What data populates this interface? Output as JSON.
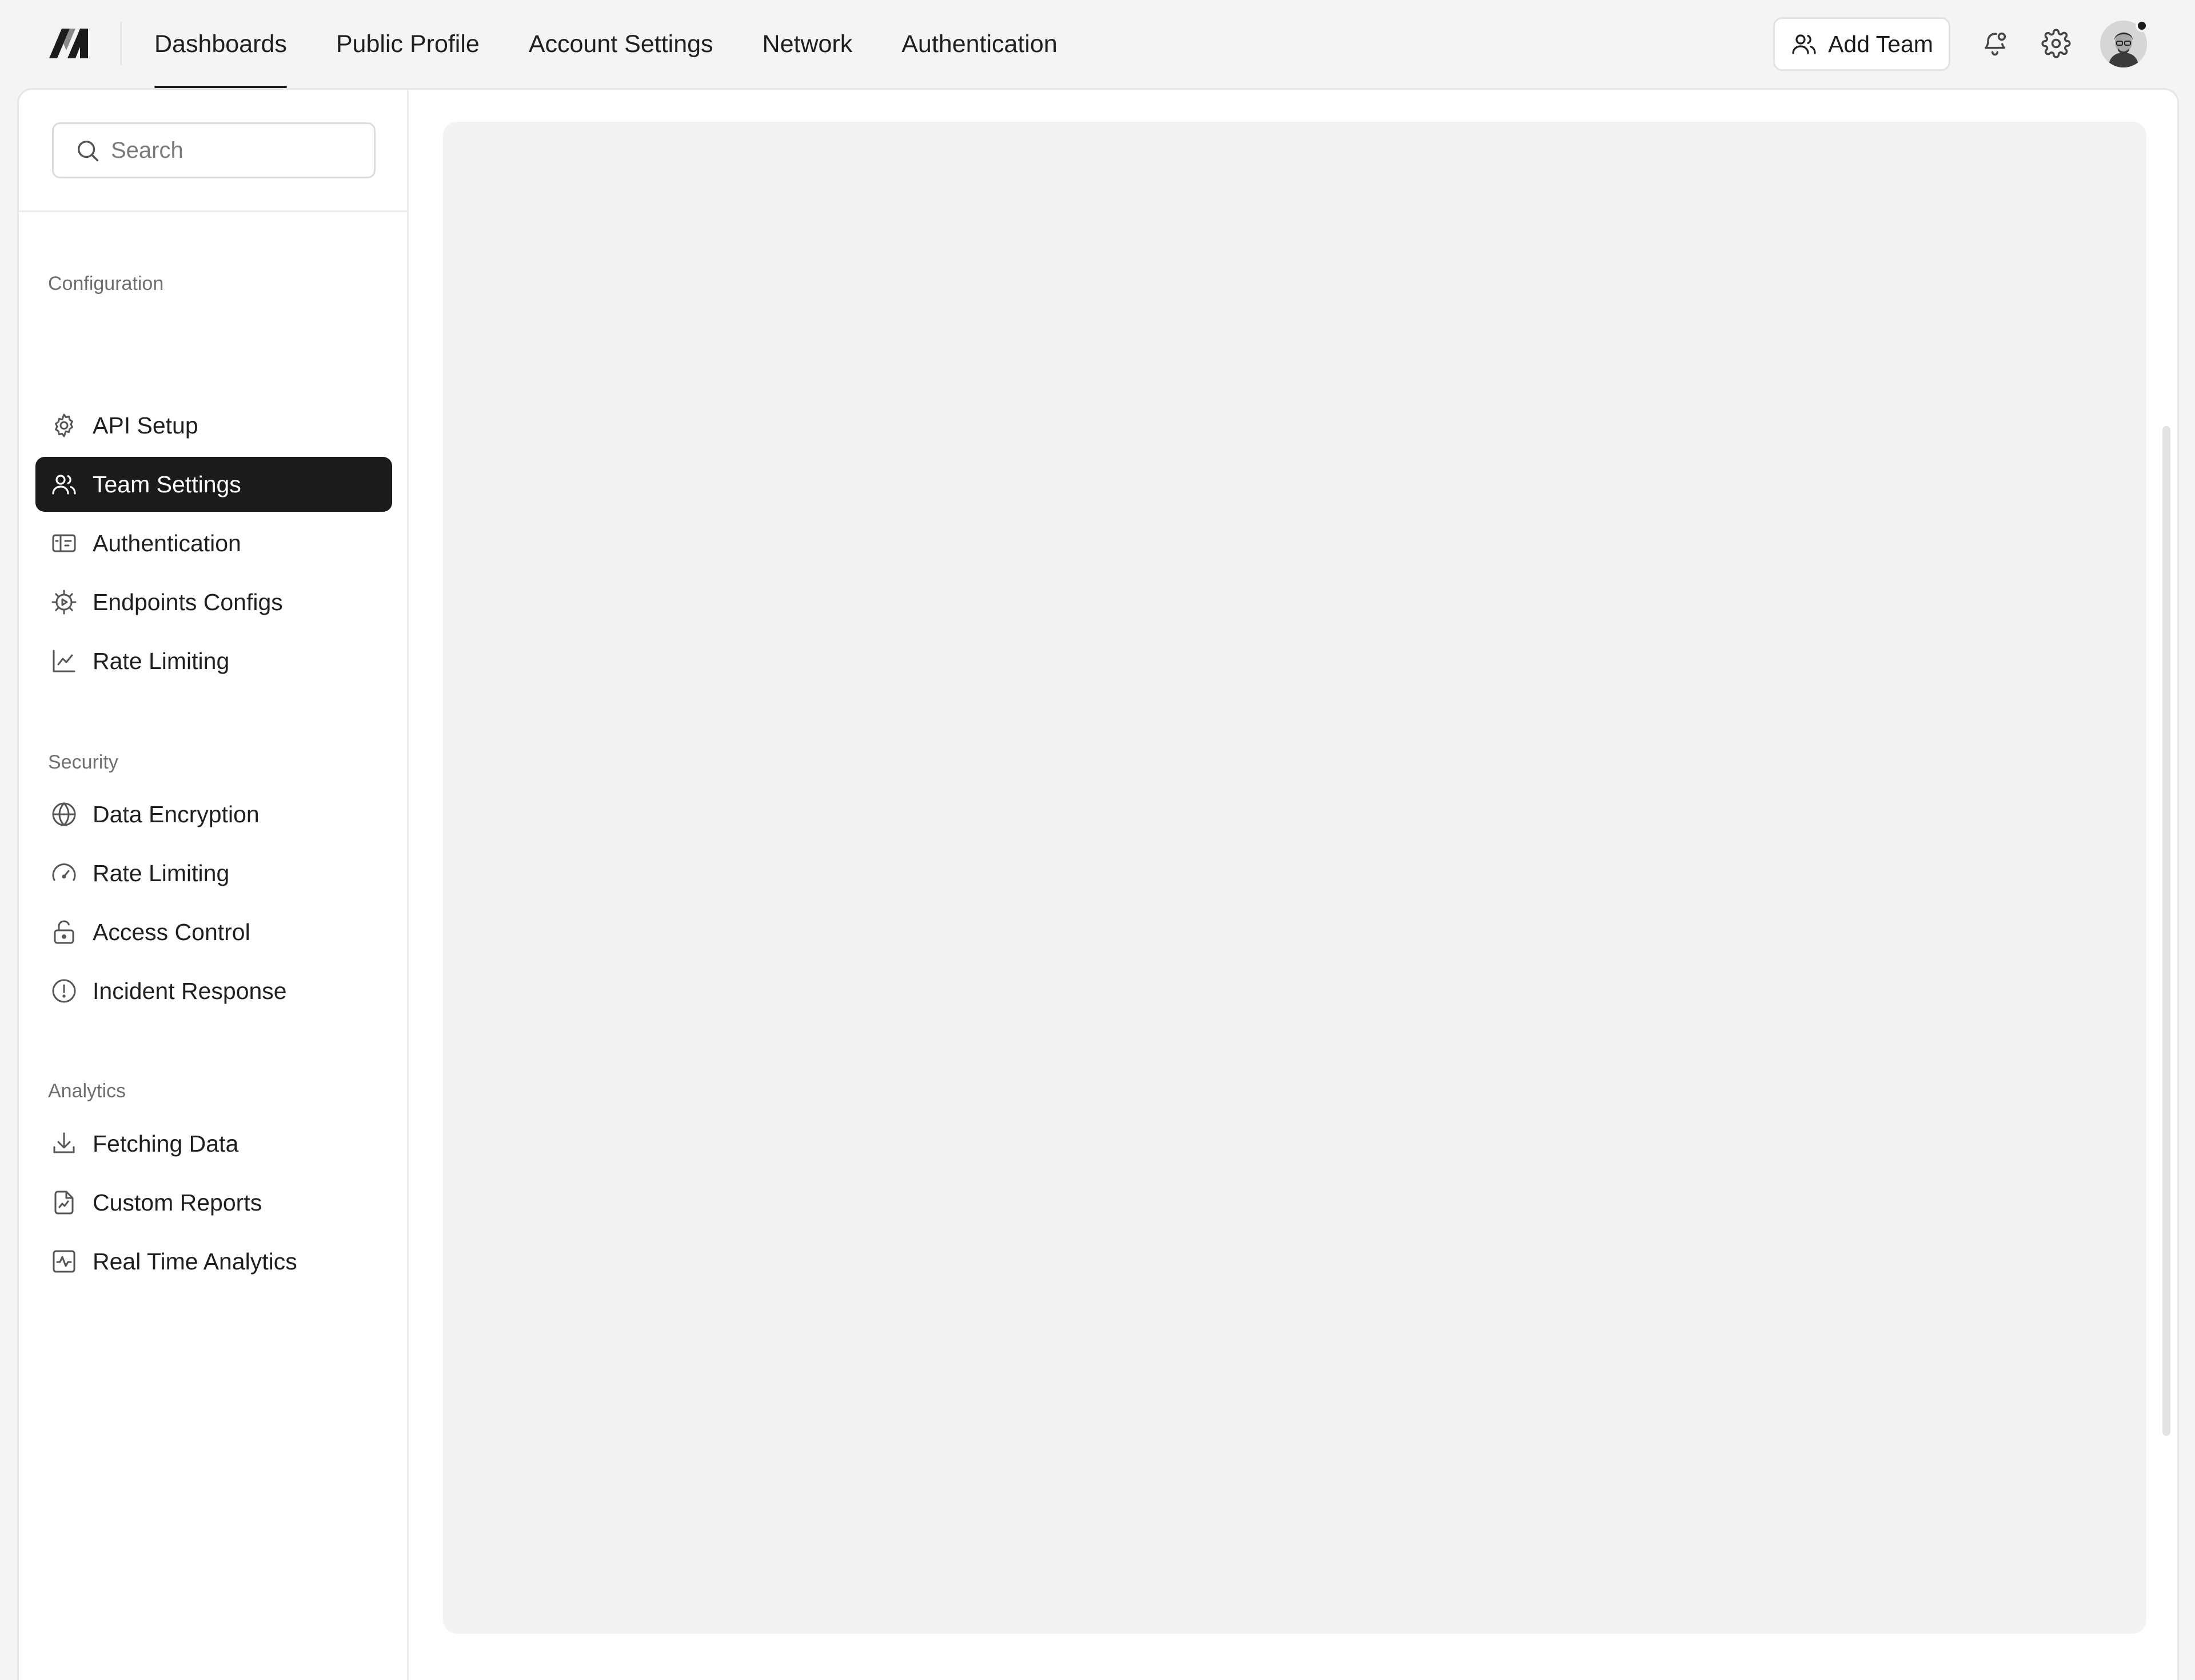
{
  "header": {
    "nav": [
      {
        "label": "Dashboards",
        "active": true
      },
      {
        "label": "Public Profile",
        "active": false
      },
      {
        "label": "Account Settings",
        "active": false
      },
      {
        "label": "Network",
        "active": false
      },
      {
        "label": "Authentication",
        "active": false
      }
    ],
    "add_team_label": "Add Team",
    "icons": [
      "users-icon",
      "bell-icon",
      "gear-icon",
      "avatar"
    ]
  },
  "sidebar": {
    "search_placeholder": "Search",
    "sections": [
      {
        "title": "Configuration",
        "items": [
          {
            "label": "API Setup",
            "icon": "gear-icon",
            "active": false
          },
          {
            "label": "Team Settings",
            "icon": "users-icon",
            "active": true
          },
          {
            "label": "Authentication",
            "icon": "id-card-icon",
            "active": false
          },
          {
            "label": "Endpoints Configs",
            "icon": "cog-play-icon",
            "active": false
          },
          {
            "label": "Rate Limiting",
            "icon": "line-chart-icon",
            "active": false
          }
        ]
      },
      {
        "title": "Security",
        "items": [
          {
            "label": "Data Encryption",
            "icon": "globe-icon",
            "active": false
          },
          {
            "label": "Rate Limiting",
            "icon": "gauge-icon",
            "active": false
          },
          {
            "label": "Access Control",
            "icon": "lock-open-icon",
            "active": false
          },
          {
            "label": "Incident Response",
            "icon": "alert-circle-icon",
            "active": false
          }
        ]
      },
      {
        "title": "Analytics",
        "items": [
          {
            "label": "Fetching Data",
            "icon": "download-icon",
            "active": false
          },
          {
            "label": "Custom Reports",
            "icon": "file-chart-icon",
            "active": false
          },
          {
            "label": "Real Time Analytics",
            "icon": "activity-square-icon",
            "active": false
          }
        ]
      }
    ]
  },
  "colors": {
    "active_bg": "#1b1b1b",
    "page_bg": "#f4f4f4",
    "panel_bg": "#f3f3f3"
  }
}
